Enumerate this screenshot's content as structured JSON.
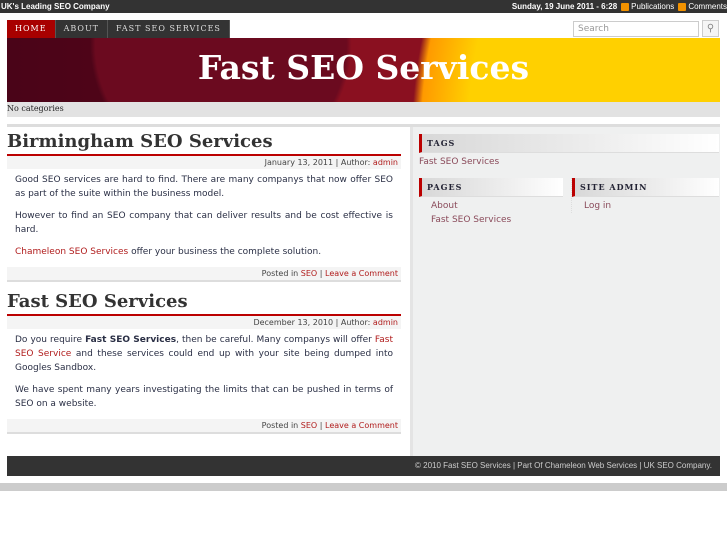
{
  "topbar": {
    "tagline": "UK's Leading SEO Company",
    "date": "Sunday, 19 June 2011 - 6:28",
    "publications": "Publications",
    "comments": "Comments"
  },
  "nav": [
    {
      "label": "HOME"
    },
    {
      "label": "ABOUT"
    },
    {
      "label": "FAST SEO SERVICES"
    }
  ],
  "search": {
    "placeholder": "Search",
    "button": "⚲"
  },
  "header": {
    "title": "Fast SEO Services"
  },
  "categories": "No categories",
  "posts": [
    {
      "title": "Birmingham SEO Services",
      "date": "January 13, 2011",
      "author_label": "| Author:",
      "author": "admin",
      "p1": "Good SEO services are hard to find. There are many companys that now offer SEO as part of the suite within the business model.",
      "p2": "However to find an SEO company that can deliver results and be cost effective is hard.",
      "p3_link": "Chameleon SEO Services",
      "p3_rest": " offer your business the complete solution.",
      "posted_in": "Posted in",
      "category": "SEO",
      "comment": "Leave a Comment"
    },
    {
      "title": "Fast SEO Services",
      "date": "December 13, 2010",
      "author_label": "| Author:",
      "author": "admin",
      "p1_a": "Do you require ",
      "p1_bold": "Fast SEO Services",
      "p1_b": ", then be careful. Many companys will offer ",
      "p1_link": "Fast SEO Service",
      "p1_c": " and these services could end up with your site being dumped into Googles Sandbox.",
      "p2": "We have spent many years investigating the limits that can be pushed in terms of SEO on a website.",
      "posted_in": "Posted in",
      "category": "SEO",
      "comment": "Leave a Comment"
    }
  ],
  "sidebar": {
    "tags_title": "TAGS",
    "tag": "Fast SEO Services",
    "pages_title": "PAGES",
    "pages": [
      "About",
      "Fast SEO Services"
    ],
    "admin_title": "SITE ADMIN",
    "login": "Log in"
  },
  "footer": "© 2010 Fast SEO Services | Part Of Chameleon Web Services | UK SEO Company."
}
